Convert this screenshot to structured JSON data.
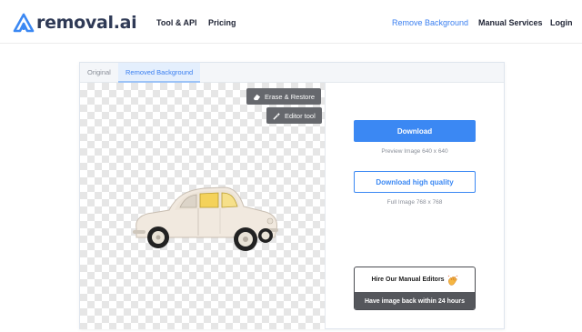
{
  "brand": {
    "name": "removal.ai",
    "accent": "#3b88f3"
  },
  "nav": {
    "tool_api": "Tool & API",
    "pricing": "Pricing",
    "remove_background": "Remove Background",
    "manual_services": "Manual Services",
    "login": "Login"
  },
  "editor": {
    "tabs": [
      {
        "label": "Original",
        "active": false
      },
      {
        "label": "Removed Background",
        "active": true
      }
    ],
    "erase_restore": "Erase & Restore",
    "editor_tool": "Editor tool"
  },
  "panel": {
    "download_label": "Download",
    "preview_info": "Preview Image   640 x 640",
    "download_hq_label": "Download high quality",
    "full_info": "Full Image   768 x 768",
    "hire_label": "Hire Our Manual Editors",
    "hire_sub": "Have image back within 24 hours"
  },
  "icons": [
    "logo-icon",
    "eraser-icon",
    "magic-wand-icon",
    "waving-hand-icon"
  ]
}
